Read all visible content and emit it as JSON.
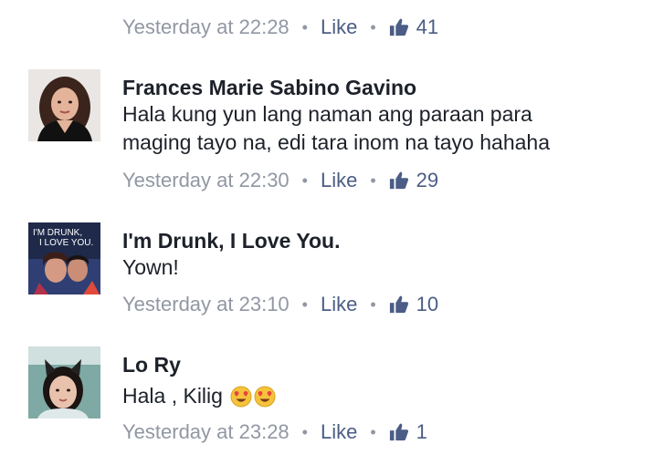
{
  "top_meta": {
    "time": "Yesterday at 22:28",
    "like": "Like",
    "count": "41"
  },
  "comments": [
    {
      "name": "Frances Marie Sabino Gavino",
      "lines": [
        "Hala kung yun lang naman ang paraan para",
        "maging tayo na, edi tara inom na tayo hahaha"
      ],
      "time": "Yesterday at 22:30",
      "like": "Like",
      "count": "29"
    },
    {
      "name": "I'm Drunk, I Love You.",
      "lines": [
        "Yown!"
      ],
      "time": "Yesterday at 23:10",
      "like": "Like",
      "count": "10",
      "avatar_text": [
        "I'M DRUNK,",
        "I LOVE YOU."
      ]
    },
    {
      "name": "Lo Ry",
      "lines": [
        "Hala , Kilig"
      ],
      "time": "Yesterday at 23:28",
      "like": "Like",
      "count": "1"
    }
  ],
  "separator": "•",
  "icons": {
    "thumb": "thumbs-up-icon",
    "emoji": "heart-eyes-emoji-icon"
  },
  "colors": {
    "meta_gray": "#9197a3",
    "link_blue": "#4b5d86",
    "text": "#1d2129"
  }
}
